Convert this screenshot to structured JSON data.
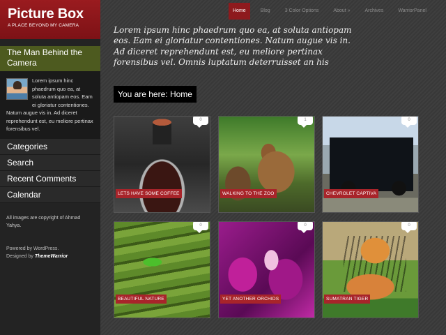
{
  "site": {
    "title": "Picture Box",
    "tagline": "A PLACE BEYOND MY CAMERA"
  },
  "nav": {
    "items": [
      {
        "label": "Home",
        "active": true
      },
      {
        "label": "Blog"
      },
      {
        "label": "3 Color Options"
      },
      {
        "label": "About  »"
      },
      {
        "label": "Archives"
      },
      {
        "label": "WarriorPanel"
      }
    ]
  },
  "sidebar": {
    "about_heading": "The Man Behind the Camera",
    "about_text": "Lorem ipsum hinc phaedrum quo ea, at soluta antiopam eos. Eam ei gloriatur contentiones. Natum augue vis in. Ad diceret reprehendunt est, eu meliore pertinax forensibus vel.",
    "widgets": [
      "Categories",
      "Search",
      "Recent Comments",
      "Calendar"
    ],
    "copyright": "All images are copyright of Ahmad Yahya.",
    "powered": "Powered by WordPress.",
    "designed_prefix": "Designed by",
    "designer": "ThemeWarrior"
  },
  "main": {
    "intro": "Lorem ipsum hinc phaedrum quo ea, at soluta antiopam eos. Eam ei gloriatur contentiones. Natum augue vis in. Ad diceret reprehendunt est, eu meliore pertinax forensibus vel. Omnis luptatum deterruisset an his",
    "breadcrumb_prefix": "You are here:",
    "breadcrumb_current": "Home",
    "posts": [
      {
        "caption": "LETS HAVE SOME COFFEE",
        "comments": "0",
        "image": "coffee"
      },
      {
        "caption": "WALKING TO THE ZOO",
        "comments": "1",
        "image": "zoo"
      },
      {
        "caption": "CHEVROLET CAPTIVA",
        "comments": "0",
        "image": "car"
      },
      {
        "caption": "BEAUTIFUL NATURE",
        "comments": "0",
        "image": "nature"
      },
      {
        "caption": "YET ANOTHER ORCHIDS",
        "comments": "0",
        "image": "orchid"
      },
      {
        "caption": "SUMATRAN TIGER",
        "comments": "0",
        "image": "tiger"
      }
    ]
  },
  "colors": {
    "brand_red": "#9a1b1f",
    "caption_red": "#a8242a",
    "about_green": "#4d5a1f"
  }
}
